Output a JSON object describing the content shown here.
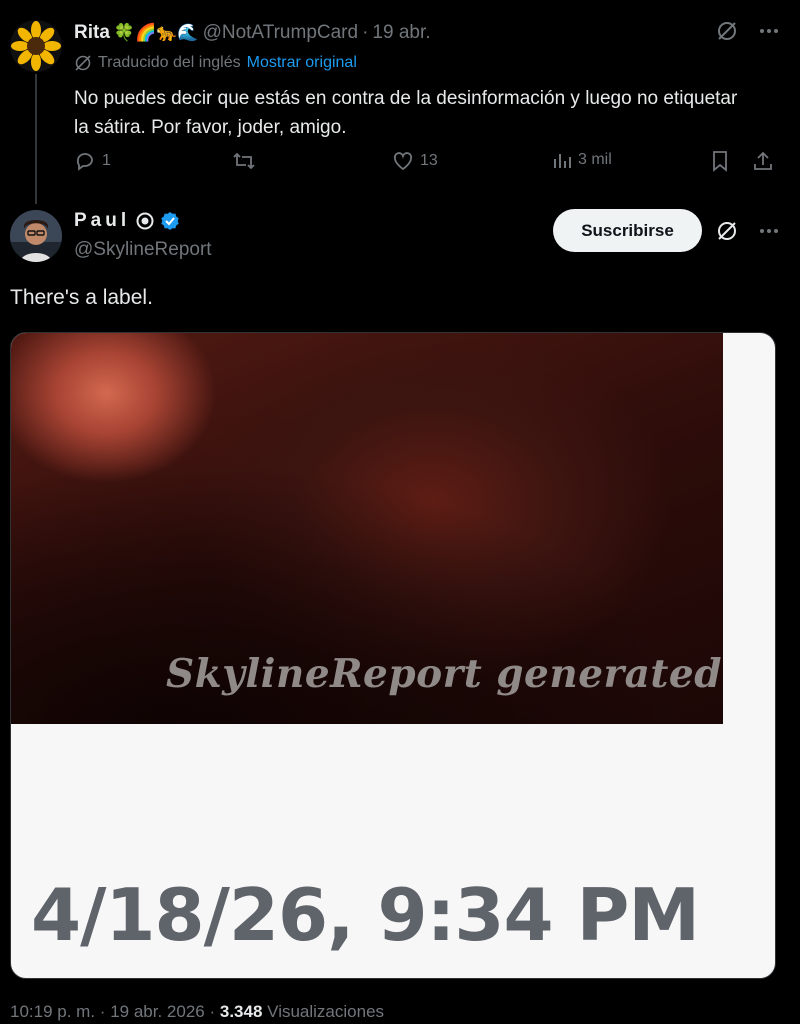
{
  "reply": {
    "display_name": "Rita",
    "name_emojis": "🍀🌈🐆🌊",
    "handle": "@NotATrumpCard",
    "separator": "·",
    "date": "19 abr.",
    "translated_label": "Traducido del inglés",
    "show_original_link": "Mostrar original",
    "text": "No puedes decir que estás en contra de la desinformación y luego no etiquetar la sátira. Por favor, joder, amigo.",
    "replies_count": "1",
    "likes_count": "13",
    "views_count": "3 mil"
  },
  "post": {
    "display_name": "Paul",
    "handle": "@SkylineReport",
    "subscribe_label": "Suscribirse",
    "text": "There's a label.",
    "media": {
      "watermark": "SkylineReport generated",
      "timestamp": "4/18/26, 9:34 PM"
    },
    "meta": {
      "time": "10:19 p. m.",
      "separator": "·",
      "date": "19 abr. 2026",
      "views_value": "3.348",
      "views_label": "Visualizaciones"
    }
  },
  "icons": {
    "verified_badge_color": "#1d9bf0",
    "link_color": "#1d9bf0"
  }
}
